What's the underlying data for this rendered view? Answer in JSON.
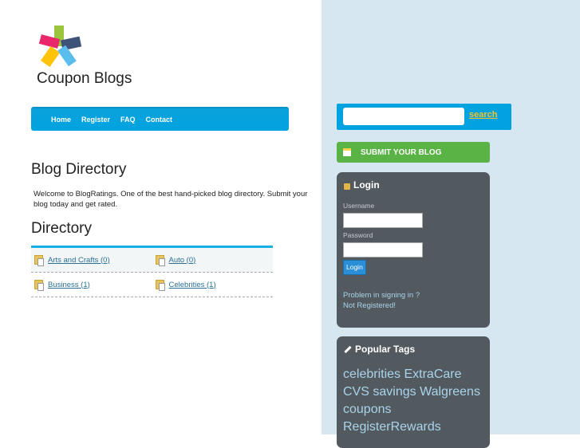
{
  "site": {
    "title": "Coupon Blogs"
  },
  "nav": [
    {
      "label": "Home"
    },
    {
      "label": "Register"
    },
    {
      "label": "FAQ"
    },
    {
      "label": "Contact"
    }
  ],
  "main": {
    "heading": "Blog Directory",
    "welcome": "Welcome to BlogRatings. One of the best hand-picked blog directory. Submit your blog today and get rated.",
    "directory_heading": "Directory",
    "categories": [
      {
        "label": "Arts and Crafts (0)"
      },
      {
        "label": "Auto (0)"
      },
      {
        "label": "Business (1)"
      },
      {
        "label": "Celebrities (1)"
      }
    ]
  },
  "sidebar": {
    "search": {
      "value": "",
      "button": "search"
    },
    "submit": "SUBMIT YOUR BLOG",
    "login": {
      "title": "Login",
      "username_label": "Username",
      "password_label": "Password",
      "button": "Login",
      "problem_link": "Problem in signing in ?",
      "register_link": "Not Registered!"
    },
    "tags": {
      "title": "Popular Tags",
      "items": [
        "celebrities",
        "ExtraCare",
        "CVS",
        "savings",
        "Walgreens",
        "coupons",
        "RegisterRewards"
      ]
    }
  },
  "colors": {
    "accent": "#00a3e0",
    "submit": "#59b345",
    "panel": "#52595f",
    "sidebar_bg": "#d7e7f2"
  }
}
